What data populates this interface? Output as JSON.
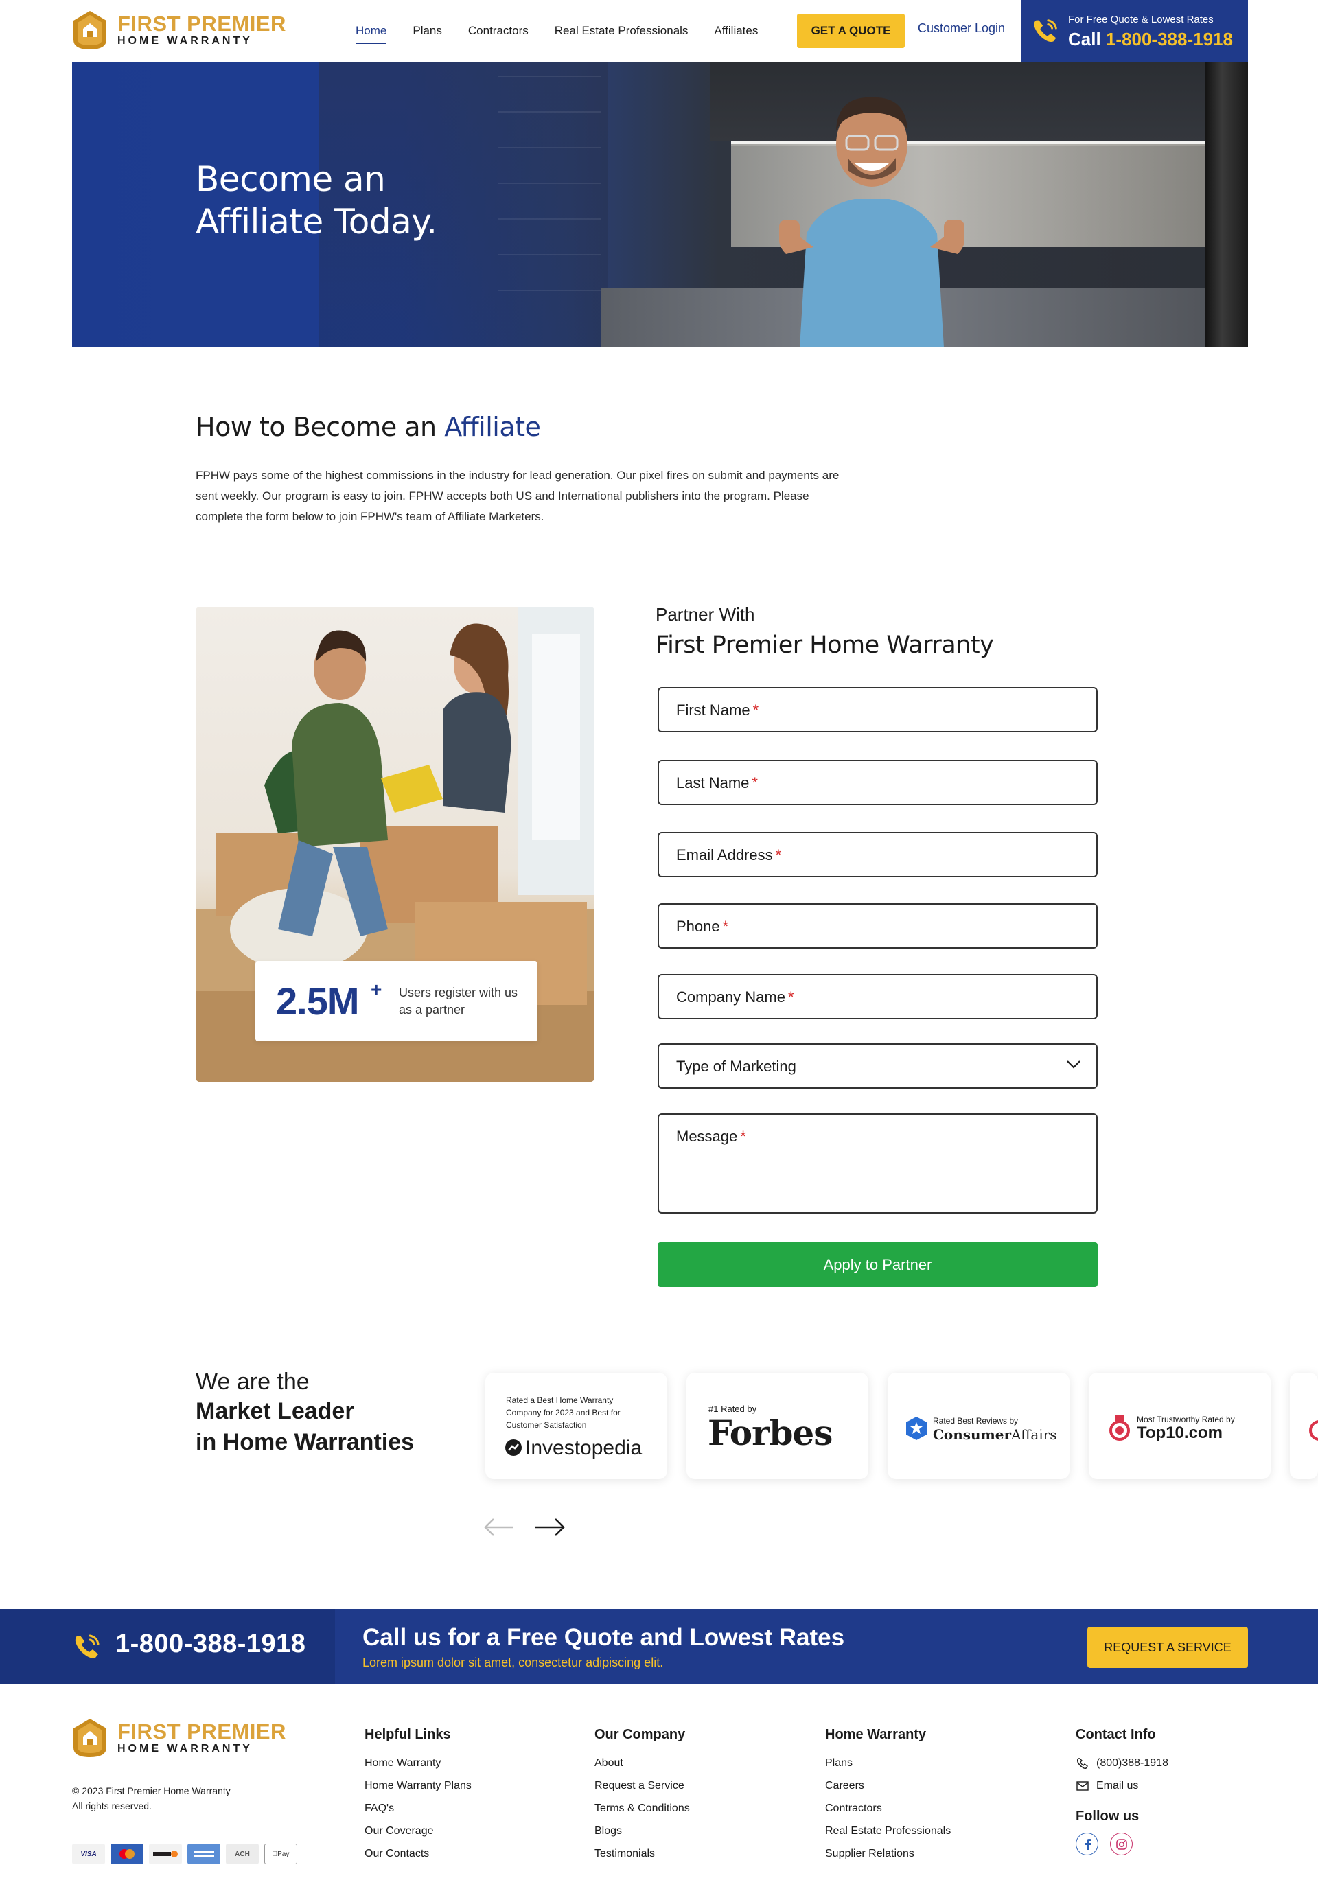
{
  "brand": {
    "name_line1": "FIRST PREMIER",
    "name_line2": "HOME WARRANTY",
    "color_gold": "#dba23a",
    "color_navy": "#1f3a8a"
  },
  "header": {
    "nav": [
      "Home",
      "Plans",
      "Contractors",
      "Real Estate Professionals",
      "Affiliates"
    ],
    "active_nav": "Home",
    "quote_button": "GET A QUOTE",
    "login_link": "Customer Login",
    "call_small": "For Free Quote & Lowest Rates",
    "call_prefix": "Call",
    "call_number": "1-800-388-1918"
  },
  "hero": {
    "title_line1": "Become an",
    "title_line2": "Affiliate Today."
  },
  "how_to": {
    "title_plain": "How to Become an",
    "title_accent": "Affiliate",
    "body": "FPHW pays some of the highest commissions in the industry for lead generation. Our pixel fires on submit and payments are sent weekly. Our program is easy to join. FPHW accepts both US and International publishers into the program. Please complete the form below to join FPHW's team of Affiliate Marketers."
  },
  "stat": {
    "value": "2.5M",
    "suffix": "+",
    "description": "Users register with us as a partner"
  },
  "form": {
    "subtitle": "Partner With",
    "title": "First Premier Home Warranty",
    "fields": {
      "first_name": "First Name",
      "last_name": "Last Name",
      "email": "Email Address",
      "phone": "Phone",
      "company": "Company Name",
      "marketing_type": "Type of Marketing",
      "message": "Message"
    },
    "required_mark": "*",
    "submit": "Apply to Partner"
  },
  "market_leader": {
    "line1": "We are the",
    "line2": "Market Leader",
    "line3": "in Home Warranties",
    "badges": {
      "investopedia_caption": "Rated a Best Home Warranty Company for 2023 and Best for Customer Satisfaction",
      "investopedia_logo": "Investopedia",
      "forbes_caption": "#1 Rated by",
      "forbes_logo": "Forbes",
      "consumer_caption": "Rated Best Reviews by",
      "consumer_logo_a": "Consumer",
      "consumer_logo_b": "Affairs",
      "top10_caption": "Most Trustworthy Rated by",
      "top10_logo": "Top10.com"
    }
  },
  "cta": {
    "phone": "1-800-388-1918",
    "heading": "Call us for a Free Quote and Lowest Rates",
    "subtext": "Lorem ipsum dolor sit amet, consectetur adipiscing elit.",
    "button": "REQUEST A SERVICE"
  },
  "footer": {
    "copyright_line1": "© 2023 First Premier Home Warranty",
    "copyright_line2": "All rights reserved.",
    "payments": [
      "VISA",
      "ACH",
      "Pay"
    ],
    "helpful_links": {
      "heading": "Helpful Links",
      "items": [
        "Home Warranty",
        "Home Warranty Plans",
        "FAQ's",
        "Our Coverage",
        "Our Contacts"
      ]
    },
    "our_company": {
      "heading": "Our Company",
      "items": [
        "About",
        "Request a Service",
        "Terms & Conditions",
        "Blogs",
        "Testimonials"
      ]
    },
    "home_warranty": {
      "heading": "Home Warranty",
      "items": [
        "Plans",
        "Careers",
        "Contractors",
        "Real Estate Professionals",
        "Supplier Relations"
      ]
    },
    "contact": {
      "heading": "Contact Info",
      "phone": "(800)388-1918",
      "email": "Email us",
      "follow": "Follow us"
    }
  }
}
